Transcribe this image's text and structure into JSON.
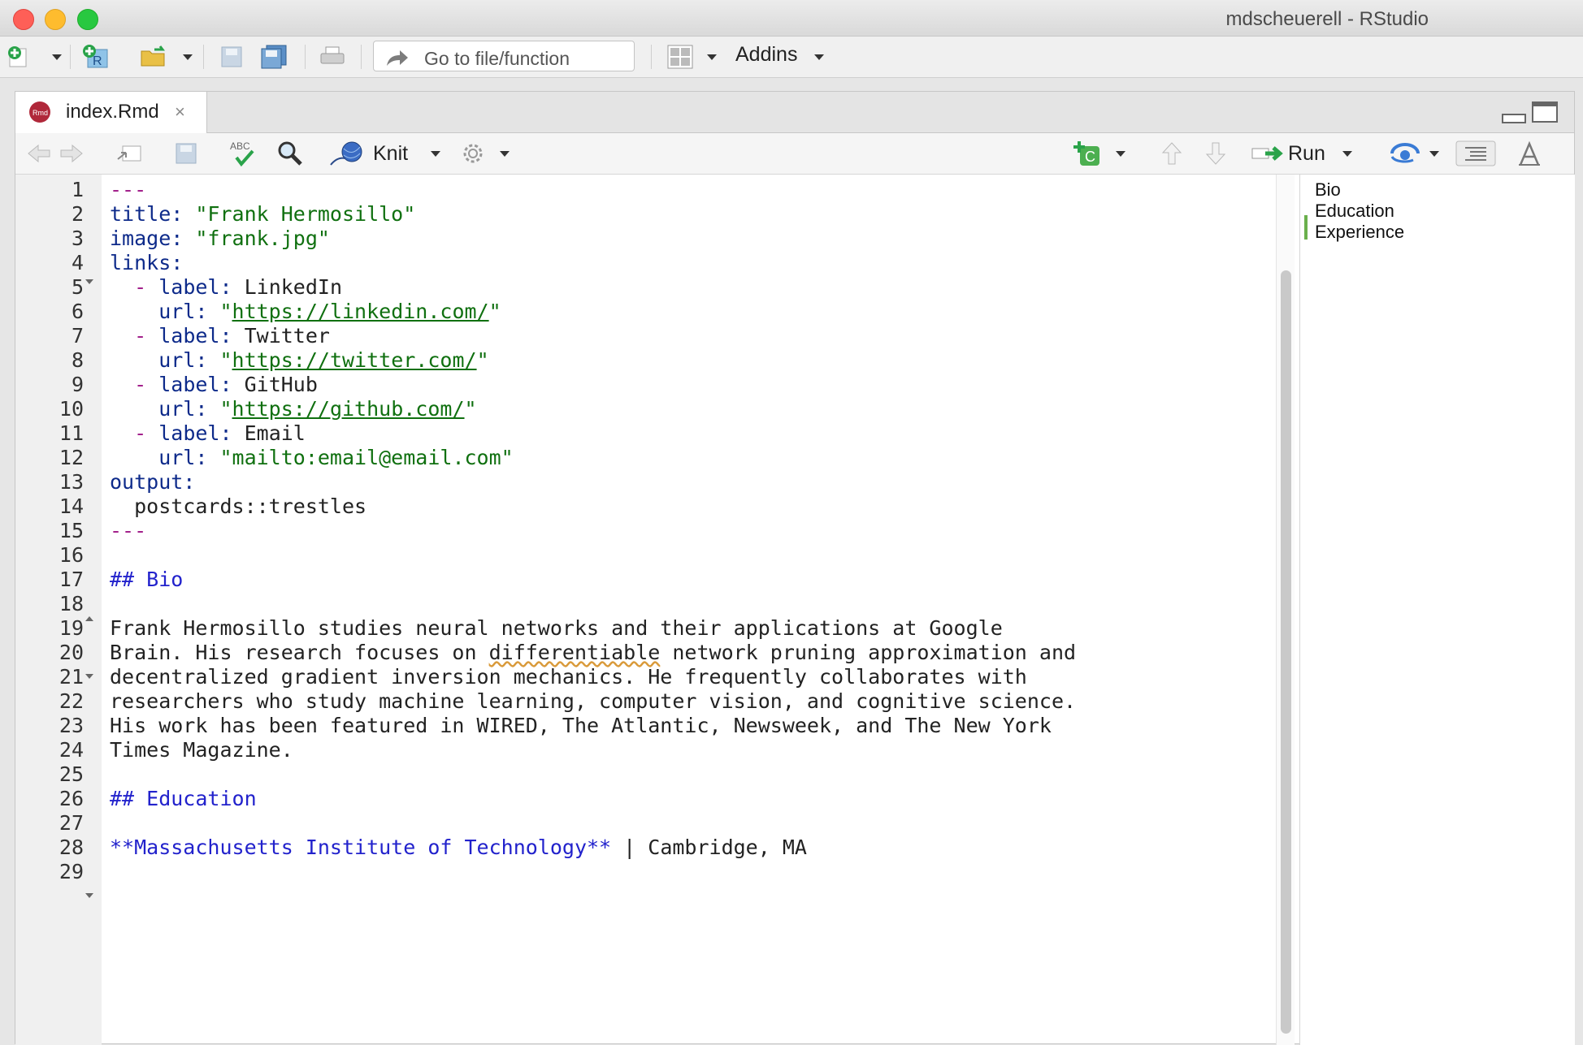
{
  "window": {
    "title": "mdscheuerell - RStudio"
  },
  "toolbar": {
    "goto_placeholder": "Go to file/function",
    "addins_label": "Addins"
  },
  "editor": {
    "tab_label": "index.Rmd",
    "tab_close": "×",
    "knit_label": "Knit",
    "run_label": "Run"
  },
  "outline": {
    "items": [
      "Bio",
      "Education",
      "Experience"
    ]
  },
  "code": {
    "line_numbers": [
      "1",
      "2",
      "3",
      "4",
      "5",
      "6",
      "7",
      "8",
      "9",
      "10",
      "11",
      "12",
      "13",
      "14",
      "15",
      "16",
      "17",
      "18",
      "19",
      "20",
      "21",
      "22",
      "23",
      "24",
      "25",
      "26",
      "27",
      "28",
      "29"
    ],
    "lines": [
      [
        {
          "t": "---",
          "c": "d"
        }
      ],
      [
        {
          "t": "title: ",
          "c": "k"
        },
        {
          "t": "\"Frank Hermosillo\"",
          "c": "s"
        }
      ],
      [
        {
          "t": "image: ",
          "c": "k"
        },
        {
          "t": "\"frank.jpg\"",
          "c": "s"
        }
      ],
      [
        {
          "t": "links:",
          "c": "k"
        }
      ],
      [
        {
          "t": "  ",
          "c": ""
        },
        {
          "t": "-",
          "c": "d"
        },
        {
          "t": " label: ",
          "c": "k"
        },
        {
          "t": "LinkedIn",
          "c": ""
        }
      ],
      [
        {
          "t": "    url: ",
          "c": "k"
        },
        {
          "t": "\"",
          "c": "s"
        },
        {
          "t": "https://linkedin.com/",
          "c": "u"
        },
        {
          "t": "\"",
          "c": "s"
        }
      ],
      [
        {
          "t": "  ",
          "c": ""
        },
        {
          "t": "-",
          "c": "d"
        },
        {
          "t": " label: ",
          "c": "k"
        },
        {
          "t": "Twitter",
          "c": ""
        }
      ],
      [
        {
          "t": "    url: ",
          "c": "k"
        },
        {
          "t": "\"",
          "c": "s"
        },
        {
          "t": "https://twitter.com/",
          "c": "u"
        },
        {
          "t": "\"",
          "c": "s"
        }
      ],
      [
        {
          "t": "  ",
          "c": ""
        },
        {
          "t": "-",
          "c": "d"
        },
        {
          "t": " label: ",
          "c": "k"
        },
        {
          "t": "GitHub",
          "c": ""
        }
      ],
      [
        {
          "t": "    url: ",
          "c": "k"
        },
        {
          "t": "\"",
          "c": "s"
        },
        {
          "t": "https://github.com/",
          "c": "u"
        },
        {
          "t": "\"",
          "c": "s"
        }
      ],
      [
        {
          "t": "  ",
          "c": ""
        },
        {
          "t": "-",
          "c": "d"
        },
        {
          "t": " label: ",
          "c": "k"
        },
        {
          "t": "Email",
          "c": ""
        }
      ],
      [
        {
          "t": "    url: ",
          "c": "k"
        },
        {
          "t": "\"mailto:email@email.com\"",
          "c": "s"
        }
      ],
      [
        {
          "t": "output:",
          "c": "k"
        }
      ],
      [
        {
          "t": "  postcards::trestles",
          "c": ""
        }
      ],
      [
        {
          "t": "---",
          "c": "d"
        }
      ],
      [],
      [
        {
          "t": "## Bio",
          "c": "h"
        }
      ],
      [],
      [
        {
          "t": "Frank Hermosillo studies neural networks and their applications at Google",
          "c": ""
        }
      ],
      [
        {
          "t": "Brain. His research focuses on ",
          "c": ""
        },
        {
          "t": "differentiable",
          "c": "sq"
        },
        {
          "t": " network pruning approximation and",
          "c": ""
        }
      ],
      [
        {
          "t": "decentralized gradient inversion mechanics. He frequently collaborates with",
          "c": ""
        }
      ],
      [
        {
          "t": "researchers who study machine learning, computer vision, and cognitive science.",
          "c": ""
        }
      ],
      [
        {
          "t": "His work has been featured in WIRED, The Atlantic, Newsweek, and The New York",
          "c": ""
        }
      ],
      [
        {
          "t": "Times Magazine.",
          "c": ""
        }
      ],
      [],
      [
        {
          "t": "## Education",
          "c": "h"
        }
      ],
      [],
      [
        {
          "t": "**Massachusetts Institute of Technology**",
          "c": "h"
        },
        {
          "t": " | Cambridge, MA",
          "c": ""
        }
      ],
      []
    ]
  },
  "colors": {
    "yaml_key": "#0d2a8a",
    "string": "#107010",
    "yaml_dash": "#a2208b",
    "markdown_heading": "#2222cc",
    "spell_underline": "#d99a3a"
  }
}
